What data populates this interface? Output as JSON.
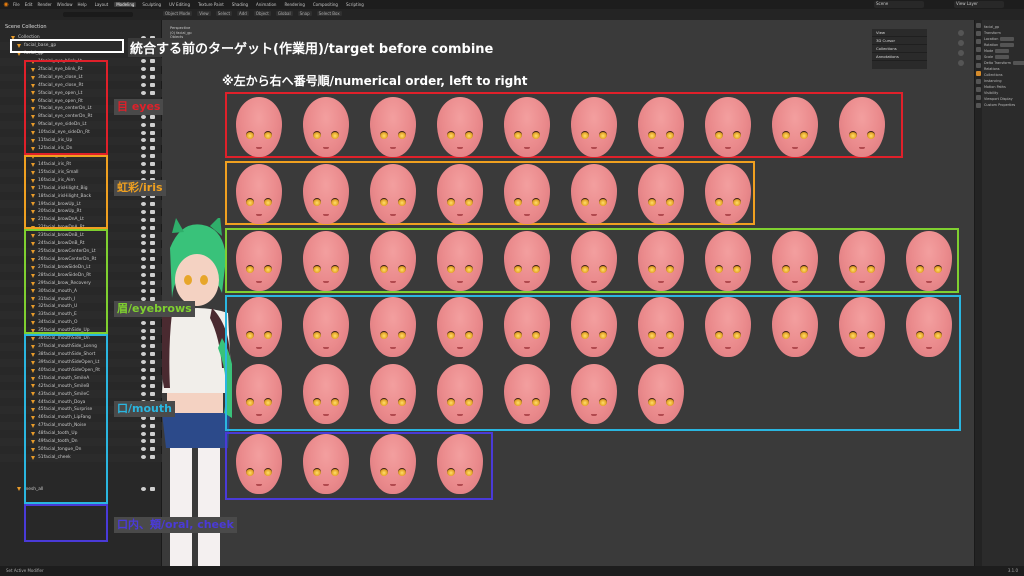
{
  "topbar": {
    "menu": [
      "File",
      "Edit",
      "Render",
      "Window",
      "Help"
    ],
    "workspace_tabs": [
      "Layout",
      "Modeling",
      "Sculpting",
      "UV Editing",
      "Texture Paint",
      "Shading",
      "Animation",
      "Rendering",
      "Compositing",
      "Scripting"
    ],
    "active_tab": "Modeling",
    "scene": "Scene",
    "view_layer": "View Layer"
  },
  "viewport_header": {
    "items": [
      "Object Mode",
      "View",
      "Select",
      "Add",
      "Object",
      "Global",
      "Snap",
      "Select Box"
    ]
  },
  "viewport_info": [
    "Perspective",
    "(0) facial_gp",
    "Objects",
    "Vertices",
    "Edges",
    "Faces"
  ],
  "npanel": [
    "View",
    "3D Cursor",
    "Collections",
    "Annotations"
  ],
  "outliner": {
    "title": "Scene Collection",
    "top_items": [
      "Collection",
      "facial_base_gp",
      "facial_gp"
    ],
    "items": [
      "1facial_eye_blink_Lt",
      "2facial_eye_blink_Rt",
      "3facial_eye_close_Lt",
      "4facial_eye_close_Rt",
      "5facial_eye_open_Lt",
      "6facial_eye_open_Rt",
      "7facial_eye_centerDn_Lt",
      "8facial_eye_centerDn_Rt",
      "9facial_eye_sideDn_Lt",
      "10facial_eye_sideDn_Rt",
      "11facial_iris_Up",
      "12facial_iris_Dn",
      "13facial_iris_Lt",
      "14facial_iris_Rt",
      "15facial_iris_Small",
      "16facial_iris_Aim",
      "17facial_irisHilight_Big",
      "18facial_irisHilight_Back",
      "19facial_browUp_Lt",
      "20facial_browUp_Rt",
      "21facial_browDnA_Lt",
      "22facial_browDnA_Rt",
      "23facial_browDnB_Lt",
      "24facial_browDnB_Rt",
      "25facial_browCenterDn_Lt",
      "26facial_browCenterDn_Rt",
      "27facial_browSideDn_Lt",
      "28facial_browSideDn_Rt",
      "29facial_brow_Recovery",
      "30facial_mouth_A",
      "31facial_mouth_I",
      "32facial_mouth_U",
      "33facial_mouth_E",
      "34facial_mouth_O",
      "35facial_mouthSide_Up",
      "36facial_mouthSide_Dn",
      "37facial_mouthSide_Lonng",
      "38facial_mouthSide_Short",
      "39facial_mouthSideOpen_Lt",
      "40facial_mouthSideOpen_Rt",
      "41facial_mouth_SmileA",
      "42facial_mouth_SmileB",
      "43facial_mouth_SmileC",
      "44facial_mouth_Doya",
      "45facial_mouth_Surprise",
      "46facial_mouth_LipFang",
      "47facial_mouth_Noise",
      "48facial_tooth_Up",
      "49facial_tooth_Dn",
      "50facial_tongue_Dn",
      "51facial_cheek"
    ],
    "bottom_item": "mesh_all"
  },
  "annotations": {
    "target": "統合する前のターゲット(作業用)/target before combine",
    "order": "※左から右へ番号順/numerical order, left to right",
    "eyes": "目 eyes",
    "iris": "虹彩/iris",
    "eyebrows": "眉/eyebrows",
    "mouth": "口/mouth",
    "oral": "口内、頬/oral, cheek"
  },
  "colors": {
    "eyes": "#e0202a",
    "iris": "#f0a020",
    "eyebrows": "#7fd030",
    "mouth": "#2ab6e0",
    "oral": "#4a3ad8",
    "target": "#ffffff"
  },
  "groups": {
    "eyes": 10,
    "iris": 8,
    "eyebrows": 11,
    "mouth_row1": 11,
    "mouth_row2": 7,
    "oral": 4
  },
  "properties": {
    "object_name": "facial_gp",
    "sections": [
      "Transform",
      "Location",
      "Rotation",
      "Mode",
      "Scale",
      "Delta Transform",
      "Relations",
      "Collections",
      "Instancing",
      "Motion Paths",
      "Visibility",
      "Viewport Display",
      "Custom Properties"
    ]
  },
  "status": {
    "left": "Set Active Modifier",
    "version": "3.1.0"
  }
}
